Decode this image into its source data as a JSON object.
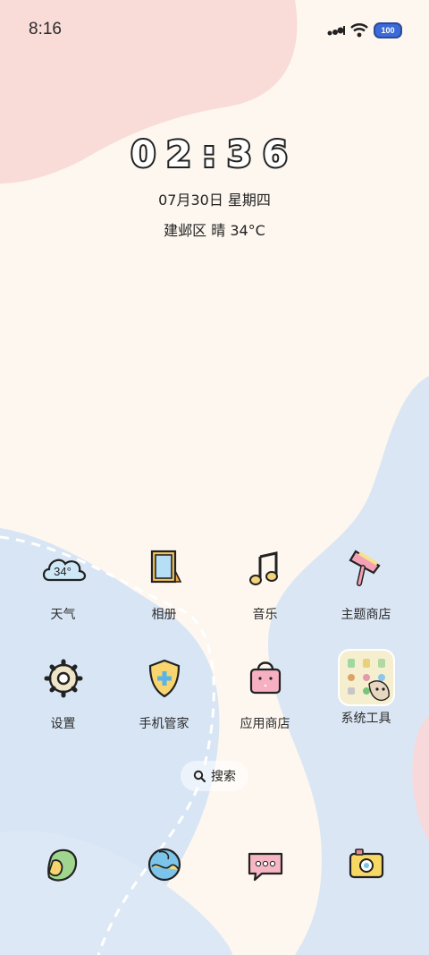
{
  "status_bar": {
    "time": "8:16",
    "battery_level": "100",
    "icons": [
      "signal-icon",
      "wifi-icon",
      "battery-icon"
    ]
  },
  "lock_widget": {
    "clock": "02:36",
    "date": "07月30日 星期四",
    "weather": "建邺区 晴 34°C"
  },
  "apps": [
    {
      "label": "天气",
      "icon": "weather-cloud-icon",
      "badge": "34°"
    },
    {
      "label": "相册",
      "icon": "photo-frame-icon"
    },
    {
      "label": "音乐",
      "icon": "music-note-icon"
    },
    {
      "label": "主题商店",
      "icon": "paint-brush-icon"
    },
    {
      "label": "设置",
      "icon": "gear-icon"
    },
    {
      "label": "手机管家",
      "icon": "shield-plus-icon"
    },
    {
      "label": "应用商店",
      "icon": "shopping-bag-icon"
    },
    {
      "label": "系统工具",
      "icon": "folder-grid-icon"
    }
  ],
  "search": {
    "label": "搜索",
    "icon": "search-icon"
  },
  "dock": [
    {
      "icon": "phone-leaf-icon"
    },
    {
      "icon": "globe-browser-icon"
    },
    {
      "icon": "message-bubble-icon"
    },
    {
      "icon": "camera-icon"
    }
  ],
  "colors": {
    "background": "#fdf7ef",
    "pink_blob": "#f9dcd8",
    "blue_blob": "#d8e6f6",
    "icon_outline": "#222222"
  }
}
